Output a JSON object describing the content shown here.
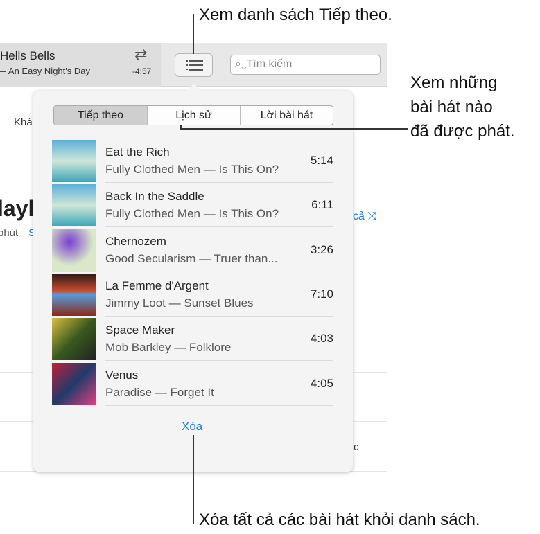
{
  "now_playing": {
    "title": "Hells Bells",
    "subtitle": "— An Easy Night's Day",
    "time_remaining": "-4:57"
  },
  "search": {
    "placeholder": "Tìm kiếm"
  },
  "background": {
    "tab_partial": "Khá",
    "heading_partial": "layl",
    "duration_partial": "phút",
    "link_partial": "S",
    "shuffle_partial": "cả",
    "cell_partial": "c"
  },
  "popover": {
    "tabs": [
      {
        "label": "Tiếp theo",
        "active": true
      },
      {
        "label": "Lịch sử"
      },
      {
        "label": "Lời bài hát"
      }
    ],
    "songs": [
      {
        "title": "Eat the Rich",
        "subtitle": "Fully Clothed Men — Is This On?",
        "duration": "5:14"
      },
      {
        "title": "Back In the Saddle",
        "subtitle": "Fully Clothed Men — Is This On?",
        "duration": "6:11"
      },
      {
        "title": "Chernozem",
        "subtitle": "Good Secularism — Truer than...",
        "duration": "3:26"
      },
      {
        "title": "La Femme d'Argent",
        "subtitle": "Jimmy Loot — Sunset Blues",
        "duration": "7:10"
      },
      {
        "title": "Space Maker",
        "subtitle": "Mob Barkley — Folklore",
        "duration": "4:03"
      },
      {
        "title": "Venus",
        "subtitle": "Paradise — Forget It",
        "duration": "4:05"
      }
    ],
    "clear_label": "Xóa"
  },
  "callouts": {
    "up_next": "Xem danh sách Tiếp theo.",
    "history": [
      "Xem những",
      "bài hát nào",
      "đã được phát."
    ],
    "clear": "Xóa tất cả các bài hát khỏi danh sách."
  },
  "colors": {
    "accent": "#1a7cf5"
  }
}
